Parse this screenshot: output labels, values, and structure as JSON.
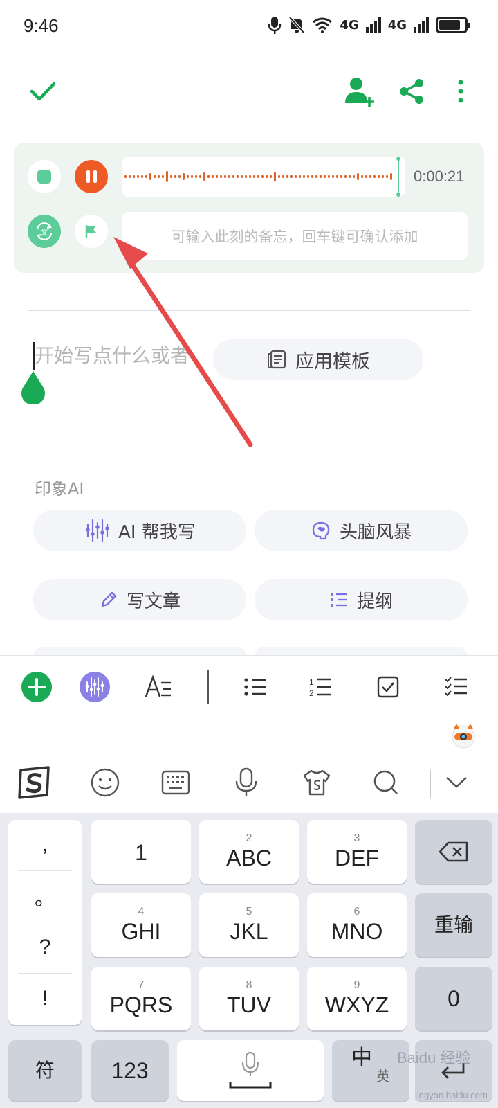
{
  "status": {
    "time": "9:46",
    "net1": "4G",
    "net2": "4G"
  },
  "recorder": {
    "elapsed": "0:00:21",
    "memo_placeholder": "可输入此刻的备忘，回车键可确认添加"
  },
  "editor": {
    "placeholder": "开始写点什么或者",
    "template_label": "应用模板"
  },
  "ai": {
    "section_title": "印象AI",
    "chips": [
      {
        "label": "AI 帮我写",
        "icon": "sparkle-icon"
      },
      {
        "label": "头脑风暴",
        "icon": "brain-icon"
      },
      {
        "label": "写文章",
        "icon": "pencil-icon"
      },
      {
        "label": "提纲",
        "icon": "outline-icon"
      }
    ]
  },
  "keyboard": {
    "punct": [
      ",",
      "。",
      "?",
      "!"
    ],
    "keys": [
      {
        "num": "",
        "label": "1"
      },
      {
        "num": "2",
        "label": "ABC"
      },
      {
        "num": "3",
        "label": "DEF"
      },
      {
        "num": "4",
        "label": "GHI"
      },
      {
        "num": "5",
        "label": "JKL"
      },
      {
        "num": "6",
        "label": "MNO"
      },
      {
        "num": "7",
        "label": "PQRS"
      },
      {
        "num": "8",
        "label": "TUV"
      },
      {
        "num": "9",
        "label": "WXYZ"
      }
    ],
    "retype": "重输",
    "zero": "0",
    "symbols": "符",
    "numbers": "123",
    "lang_main": "中",
    "lang_sub": "英"
  },
  "watermark": {
    "main": "Baidu 经验",
    "sub": "jingyan.baidu.com"
  },
  "colors": {
    "accent": "#1aaa55",
    "record": "#ee5a24",
    "ai_purple": "#7b6fe0"
  }
}
